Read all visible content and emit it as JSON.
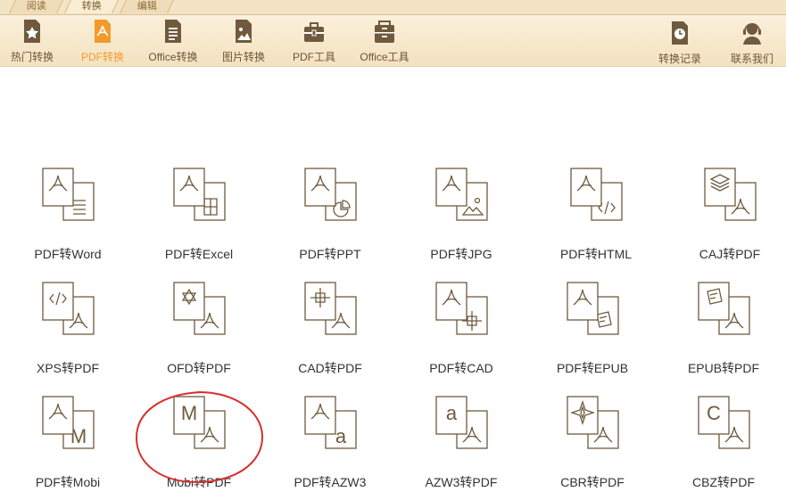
{
  "tabs": [
    "阅读",
    "转换",
    "编辑"
  ],
  "toolbar": {
    "items": [
      {
        "label": "热门转换",
        "icon": "star-doc-icon"
      },
      {
        "label": "PDF转换",
        "icon": "pdf-doc-icon"
      },
      {
        "label": "Office转换",
        "icon": "document-icon"
      },
      {
        "label": "图片转换",
        "icon": "image-icon"
      },
      {
        "label": "PDF工具",
        "icon": "toolbox-icon"
      },
      {
        "label": "Office工具",
        "icon": "cabinet-icon"
      }
    ],
    "right_items": [
      {
        "label": "转换记录",
        "icon": "clock-icon"
      },
      {
        "label": "联系我们",
        "icon": "headset-icon"
      }
    ]
  },
  "conversions": [
    {
      "label": "PDF转Word",
      "front": "pdf",
      "back": "lines"
    },
    {
      "label": "PDF转Excel",
      "front": "pdf",
      "back": "grid"
    },
    {
      "label": "PDF转PPT",
      "front": "pdf",
      "back": "pie"
    },
    {
      "label": "PDF转JPG",
      "front": "pdf",
      "back": "mountain"
    },
    {
      "label": "PDF转HTML",
      "front": "pdf",
      "back": "code"
    },
    {
      "label": "CAJ转PDF",
      "front": "layers",
      "back": "pdf"
    },
    {
      "label": "XPS转PDF",
      "front": "code",
      "back": "pdf"
    },
    {
      "label": "OFD转PDF",
      "front": "star",
      "back": "pdf"
    },
    {
      "label": "CAD转PDF",
      "front": "cross",
      "back": "pdf"
    },
    {
      "label": "PDF转CAD",
      "front": "pdf",
      "back": "cross"
    },
    {
      "label": "PDF转EPUB",
      "front": "pdf",
      "back": "epub"
    },
    {
      "label": "EPUB转PDF",
      "front": "epub",
      "back": "pdf"
    },
    {
      "label": "PDF转Mobi",
      "front": "pdf",
      "back": "M"
    },
    {
      "label": "Mobi转PDF",
      "front": "M",
      "back": "pdf"
    },
    {
      "label": "PDF转AZW3",
      "front": "pdf",
      "back": "a"
    },
    {
      "label": "AZW3转PDF",
      "front": "a",
      "back": "pdf"
    },
    {
      "label": "CBR转PDF",
      "front": "sparkle",
      "back": "pdf"
    },
    {
      "label": "CBZ转PDF",
      "front": "C",
      "back": "pdf"
    }
  ],
  "colors": {
    "accent": "#f39a2b",
    "icon": "#6f5a3e",
    "annotation": "#d4312d"
  }
}
